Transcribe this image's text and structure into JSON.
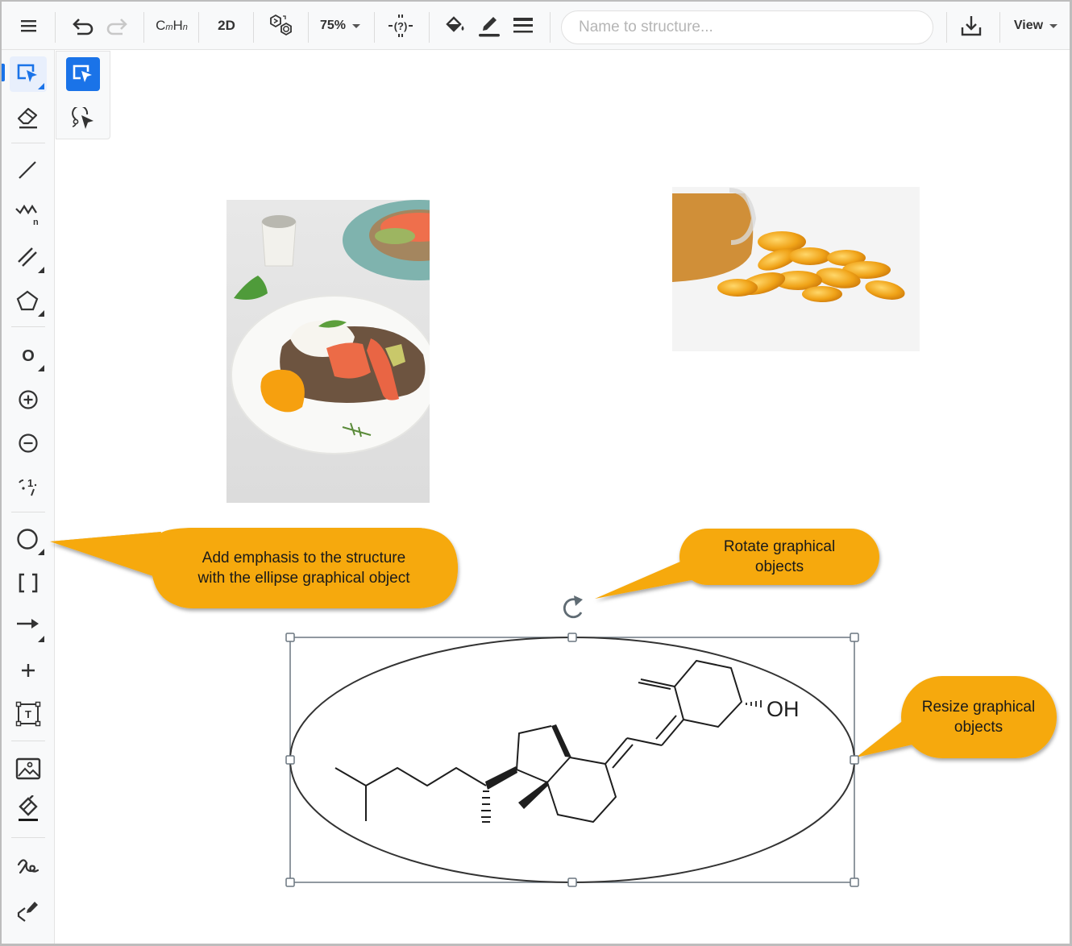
{
  "toolbar": {
    "menu_icon": "hamburger-menu-icon",
    "undo_icon": "undo-icon",
    "redo_icon": "redo-icon",
    "formula_label_c": "C",
    "formula_label_m": "m",
    "formula_label_h": "H",
    "formula_label_n": "n",
    "clean_2d_label": "2D",
    "aromatize_icon": "aromatize-icon",
    "zoom_value": "75%",
    "query_atom_icon": "query-atom-icon",
    "fill_icon": "fill-color-icon",
    "stroke_icon": "stroke-color-icon",
    "line_style_icon": "line-style-icon",
    "name_to_structure_placeholder": "Name to structure...",
    "name_to_structure_value": "",
    "download_icon": "download-icon",
    "view_label": "View"
  },
  "leftbar": {
    "tools": [
      {
        "name": "selection-tool",
        "icon": "rectangle-selection-icon",
        "active": true
      },
      {
        "name": "eraser-tool",
        "icon": "eraser-icon"
      },
      {
        "name": "single-bond-tool",
        "icon": "single-bond-icon"
      },
      {
        "name": "chain-tool",
        "icon": "chain-icon",
        "sub": "n"
      },
      {
        "name": "bond-types-tool",
        "icon": "double-bond-icon"
      },
      {
        "name": "ring-tool",
        "icon": "pentagon-icon"
      },
      {
        "name": "atom-tool",
        "icon": "atom-icon",
        "label": "O"
      },
      {
        "name": "positive-charge-tool",
        "icon": "plus-charge-icon"
      },
      {
        "name": "negative-charge-tool",
        "icon": "minus-charge-icon"
      },
      {
        "name": "atom-map-tool",
        "icon": "atom-map-icon",
        "label": "1"
      },
      {
        "name": "ellipse-tool",
        "icon": "ellipse-icon"
      },
      {
        "name": "bracket-tool",
        "icon": "bracket-icon"
      },
      {
        "name": "arrow-tool",
        "icon": "arrow-icon"
      },
      {
        "name": "reaction-plus-tool",
        "icon": "plus-icon"
      },
      {
        "name": "text-tool",
        "icon": "text-box-icon",
        "label": "T"
      },
      {
        "name": "image-tool",
        "icon": "image-icon"
      },
      {
        "name": "drawing-style-tool",
        "icon": "paint-brush-icon"
      },
      {
        "name": "freehand-tool",
        "icon": "freehand-icon"
      },
      {
        "name": "pen-tool",
        "icon": "pen-icon"
      }
    ]
  },
  "flyout": {
    "items": [
      {
        "name": "rectangle-selection",
        "icon": "rectangle-selection-icon",
        "selected": true
      },
      {
        "name": "lasso-selection",
        "icon": "lasso-selection-icon",
        "selected": false
      }
    ]
  },
  "canvas": {
    "images": [
      {
        "name": "food-photo",
        "description": "Toast with smoked salmon, avocado and poached egg on a white plate"
      },
      {
        "name": "capsules-photo",
        "description": "Golden softgel capsules spilling from a bottle"
      }
    ],
    "molecule": {
      "name": "vitamin-d3-structure",
      "hydroxyl_label": "OH"
    },
    "callouts": [
      {
        "name": "ellipse-callout",
        "lines": [
          "Add emphasis to the structure",
          "with the ellipse graphical object"
        ]
      },
      {
        "name": "rotate-callout",
        "lines": [
          "Rotate graphical",
          "objects"
        ]
      },
      {
        "name": "resize-callout",
        "lines": [
          "Resize graphical",
          "objects"
        ]
      }
    ],
    "colors": {
      "callout_fill": "#f6a90c",
      "accent": "#1a73e8",
      "selection_frame": "#6b7780"
    }
  }
}
